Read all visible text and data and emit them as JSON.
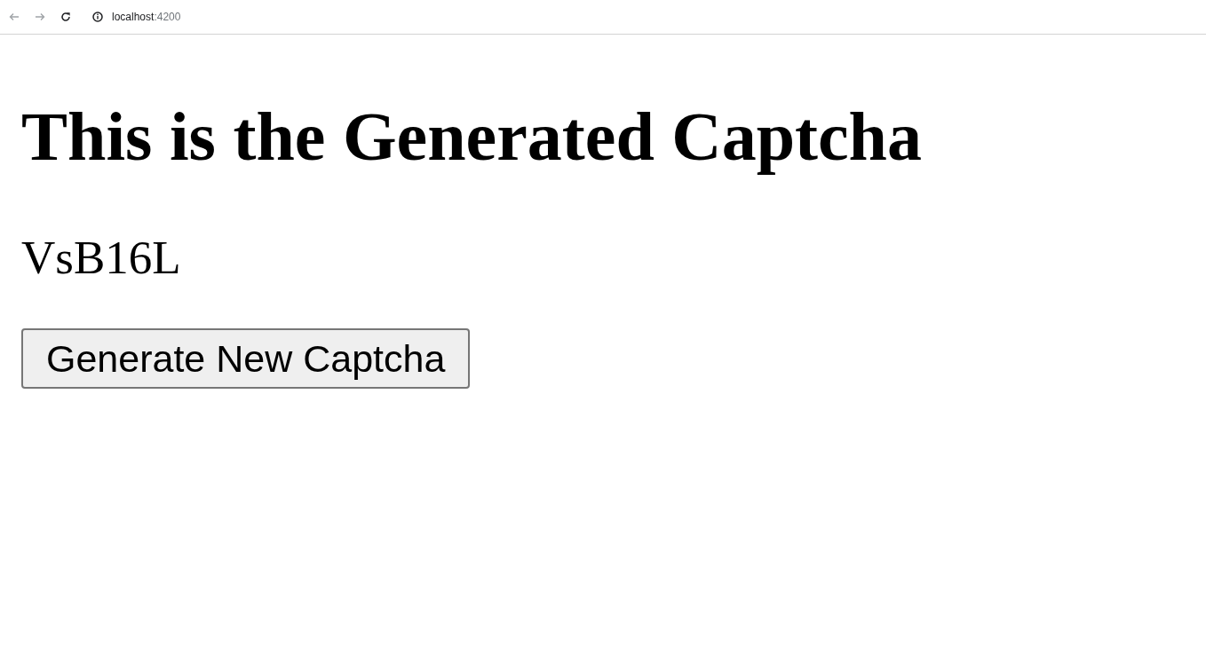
{
  "browser": {
    "nav_buttons": [
      {
        "kind": "back",
        "disabled": true
      },
      {
        "kind": "forward",
        "disabled": true
      },
      {
        "kind": "reload",
        "disabled": false
      }
    ],
    "address": {
      "host": "localhost",
      "port": ":4200"
    }
  },
  "page": {
    "heading": "This is the Generated Captcha",
    "captcha": "VsB16L",
    "button": "Generate New Captcha"
  }
}
